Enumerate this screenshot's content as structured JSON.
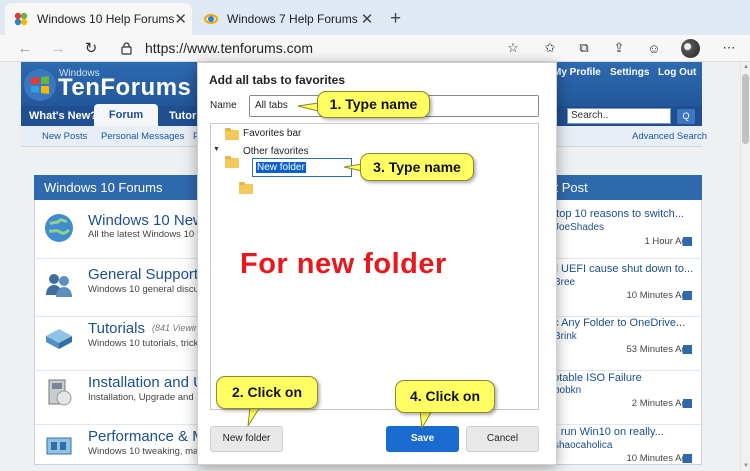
{
  "browser": {
    "tabs": [
      {
        "title": "Windows 10 Help Forums",
        "close": "✕"
      },
      {
        "title": "Windows 7 Help Forums",
        "close": "✕"
      }
    ],
    "new_tab": "+",
    "url": "https://www.tenforums.com"
  },
  "site": {
    "logo_small": "Windows",
    "logo_big": "TenForums",
    "nav": [
      "What's New?",
      "Forum",
      "Tutorials"
    ],
    "top_links": [
      "My Profile",
      "Settings",
      "Log Out"
    ],
    "search_placeholder": "Search..",
    "search_button": "Q",
    "subnav": [
      "New Posts",
      "Personal Messages",
      "P"
    ],
    "advanced_search": "Advanced Search",
    "panel_title": "Windows 10 Forums",
    "last_post_header": "st Post",
    "forums": [
      {
        "title": "Windows 10 New",
        "desc": "All the latest Windows 10 N",
        "views": "",
        "last_title": "e top 10 reasons to switch...",
        "last_user": "JoeShades",
        "last_time": "1 Hour Ago"
      },
      {
        "title": "General Support",
        "desc": "Windows 10 general discus",
        "views": "",
        "last_title": "ell UEFI cause shut down to...",
        "last_user": "Bree",
        "last_time": "10 Minutes Ago"
      },
      {
        "title": "Tutorials",
        "desc": "Windows 10 tutorials, trick",
        "views": "(841 Viewin",
        "last_title": "nc Any Folder to OneDrive...",
        "last_user": "Brink",
        "last_time": "53 Minutes Ago"
      },
      {
        "title": "Installation and U",
        "desc": "Installation, Upgrade and S",
        "views": "",
        "last_title": "ootable ISO Failure",
        "last_user": "bobkn",
        "last_time": "2 Minutes Ago"
      },
      {
        "title": "Performance & M",
        "desc": "Windows 10 tweaking, mai",
        "views": "",
        "last_title": "t's run Win10 on really...",
        "last_user": "shaocaholica",
        "last_time": "10 Minutes Ago"
      }
    ]
  },
  "dialog": {
    "title": "Add all tabs to favorites",
    "name_label": "Name",
    "name_value": "All tabs",
    "tree": [
      {
        "label": "Favorites bar"
      },
      {
        "label": "Other favorites"
      }
    ],
    "new_folder_value": "New folder",
    "buttons": {
      "new_folder": "New folder",
      "save": "Save",
      "cancel": "Cancel"
    }
  },
  "annotations": {
    "step1": "1. Type name",
    "step2": "2. Click on",
    "step3": "3. Type name",
    "step4": "4. Click on",
    "note": "For new folder"
  },
  "colors": {
    "accent": "#1a6bd0",
    "callout": "#ffff63",
    "note": "#e8181c",
    "header": "#2d6ab0"
  }
}
